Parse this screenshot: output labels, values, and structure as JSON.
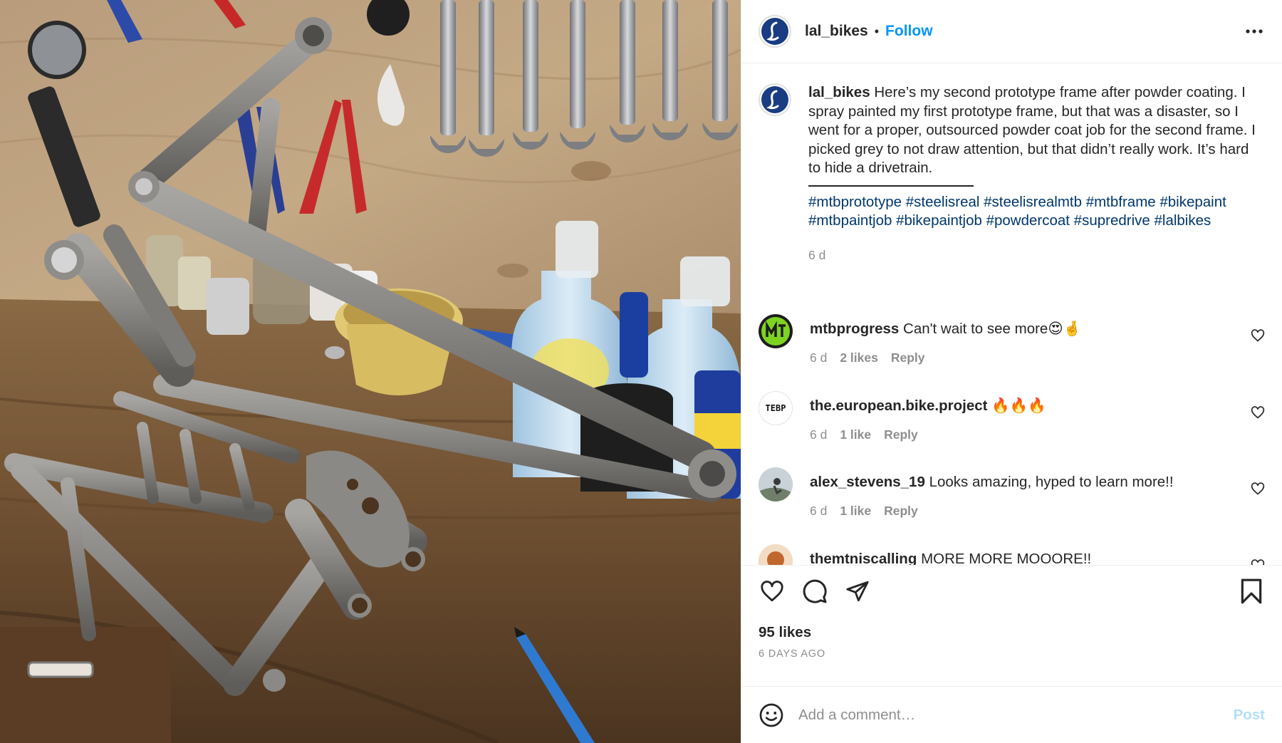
{
  "post": {
    "account": {
      "username": "lal_bikes",
      "follow_label": "Follow",
      "separator": "•",
      "brand_color": "#1a3c82"
    },
    "caption": {
      "username": "lal_bikes",
      "text": "Here’s my second prototype frame after powder coating. I spray painted my first prototype frame, but that was a disaster, so I went for a proper, outsourced powder coat job for the second frame. I picked grey to not draw attention, but that didn’t really work. It’s hard to hide a drivetrain.",
      "hashtags": "#mtbprototype #steelisreal #steelisrealmtb #mtbframe #bikepaint #mtbpaintjob #bikepaintjob #powdercoat #supredrive #lalbikes",
      "time": "6 d"
    },
    "comments": [
      {
        "username": "mtbprogress",
        "text": "Can't wait to see more😍🤞",
        "time": "6 d",
        "likes": "2 likes",
        "reply": "Reply"
      },
      {
        "username": "the.european.bike.project",
        "text": "🔥🔥🔥",
        "time": "6 d",
        "likes": "1 like",
        "reply": "Reply",
        "avatar_text": "TEBP"
      },
      {
        "username": "alex_stevens_19",
        "text": "Looks amazing, hyped to learn more!!",
        "time": "6 d",
        "likes": "1 like",
        "reply": "Reply"
      },
      {
        "username": "themtniscalling",
        "text": "MORE MORE MOOORE!!"
      }
    ],
    "likes_count": "95 likes",
    "posted_date": "6 DAYS AGO",
    "add_comment": {
      "placeholder": "Add a comment…",
      "post_label": "Post"
    },
    "icons": {
      "more": "more-options-icon",
      "like": "heart-icon",
      "comment": "comment-icon",
      "share": "share-icon",
      "save": "bookmark-icon",
      "emoji": "emoji-icon"
    },
    "colors": {
      "accent_link": "#0095f6",
      "hashtag": "#00376b",
      "muted": "#8e8e8e",
      "post_disabled": "#b2dffc"
    }
  }
}
